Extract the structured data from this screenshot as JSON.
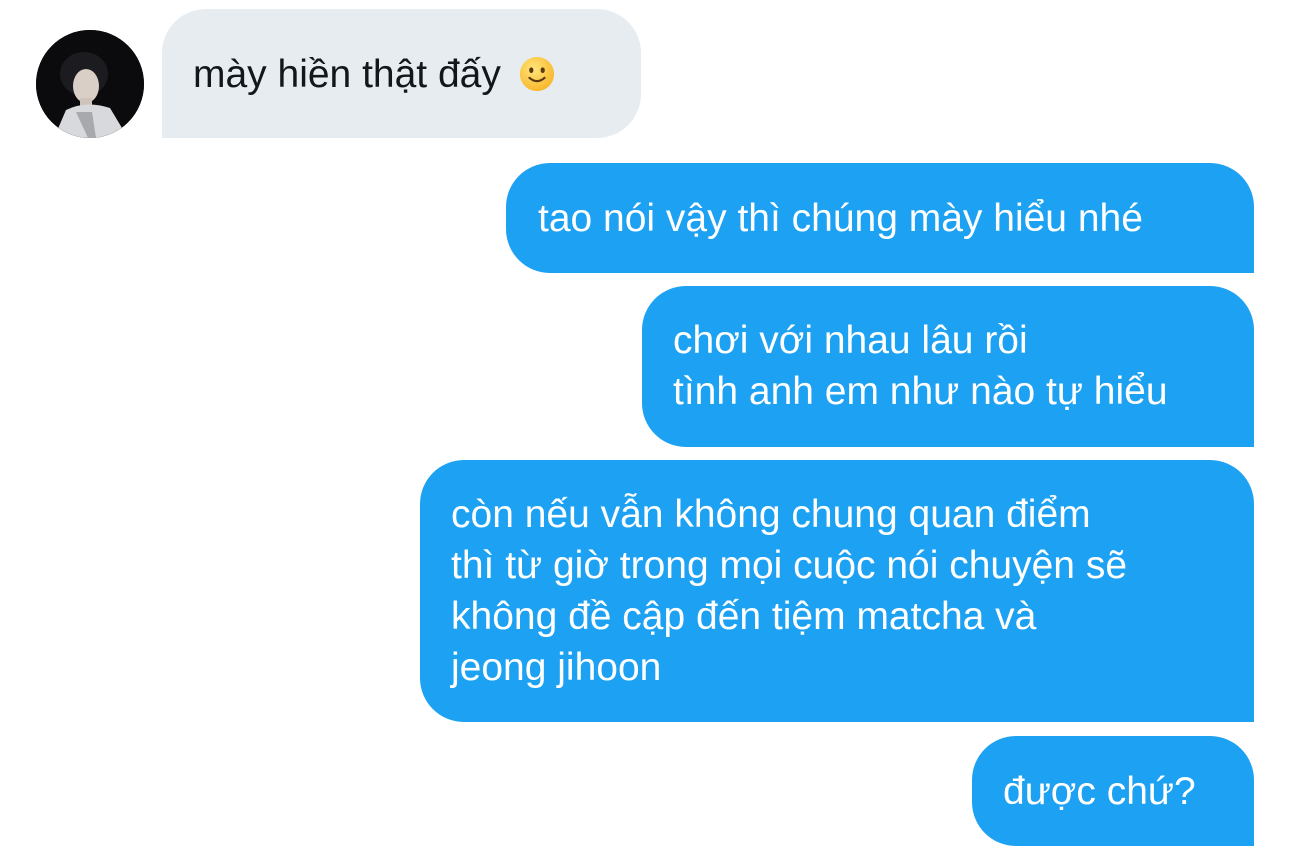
{
  "conversation": {
    "received": {
      "text": "mày hiền thật đấy",
      "emoji": "slightly-smiling-face-emoji"
    },
    "sent": [
      {
        "lines": [
          "tao nói vậy thì chúng mày hiểu nhé"
        ]
      },
      {
        "lines": [
          "chơi với nhau lâu rồi",
          "tình anh em như nào tự hiểu"
        ]
      },
      {
        "lines": [
          "còn nếu vẫn không chung quan điểm",
          "thì từ giờ trong mọi cuộc nói chuyện sẽ",
          "không đề cập đến tiệm matcha và",
          "jeong jihoon"
        ]
      },
      {
        "lines": [
          "được chứ?"
        ]
      }
    ]
  },
  "colors": {
    "incoming_bubble": "#e6ecf0",
    "incoming_text": "#14171a",
    "outgoing_bubble": "#1da1f2",
    "outgoing_text": "#ffffff",
    "background": "#ffffff"
  }
}
